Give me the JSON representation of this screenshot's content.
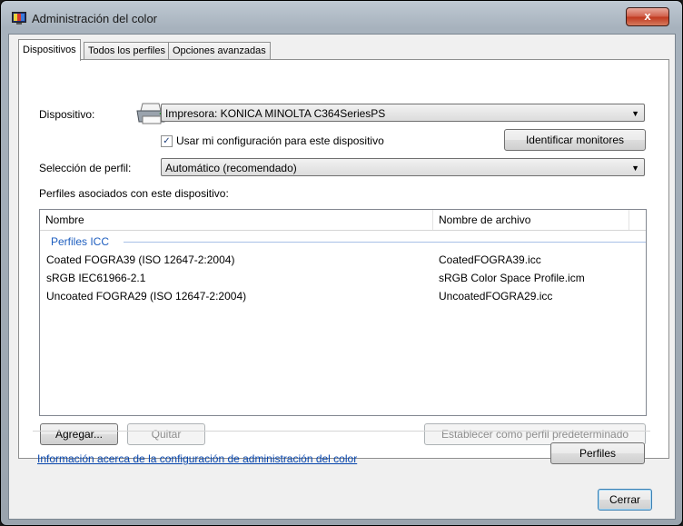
{
  "window": {
    "title": "Administración del color",
    "close_label": "x"
  },
  "tabs": [
    {
      "label": "Dispositivos",
      "active": true
    },
    {
      "label": "Todos los perfiles",
      "active": false
    },
    {
      "label": "Opciones avanzadas",
      "active": false
    }
  ],
  "device": {
    "label": "Dispositivo:",
    "value": "Impresora: KONICA MINOLTA C364SeriesPS",
    "use_settings_checkbox": {
      "label": "Usar mi configuración para este dispositivo",
      "checked": true
    },
    "identify_button": "Identificar monitores"
  },
  "profile_selection": {
    "label": "Selección de perfil:",
    "value": "Automático (recomendado)"
  },
  "associated_profiles": {
    "label": "Perfiles asociados con este dispositivo:",
    "columns": [
      "Nombre",
      "Nombre de archivo"
    ],
    "group": "Perfiles ICC",
    "rows": [
      {
        "name": "Coated FOGRA39 (ISO 12647-2:2004)",
        "file": "CoatedFOGRA39.icc"
      },
      {
        "name": "sRGB IEC61966-2.1",
        "file": "sRGB Color Space Profile.icm"
      },
      {
        "name": "Uncoated FOGRA29 (ISO 12647-2:2004)",
        "file": "UncoatedFOGRA29.icc"
      }
    ]
  },
  "buttons": {
    "add": "Agregar...",
    "remove": "Quitar",
    "set_default": "Establecer como perfil predeterminado",
    "profiles": "Perfiles",
    "close": "Cerrar"
  },
  "info_link": "Información acerca de la configuración de administración del color",
  "icons": {
    "app": "color-management-icon",
    "device": "printer-icon"
  }
}
